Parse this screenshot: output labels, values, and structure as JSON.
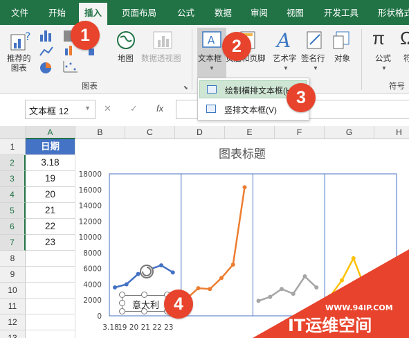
{
  "tabs": [
    "文件",
    "开始",
    "插入",
    "页面布局",
    "公式",
    "数据",
    "审阅",
    "视图",
    "开发工具",
    "形状格式"
  ],
  "ribbon": {
    "recommended_chart": "推荐的\n图表",
    "map": "地图",
    "pivot_chart": "数据透视图",
    "group_chart": "图表",
    "textbox": "文本框",
    "header_footer": "页眉和页脚",
    "wordart": "艺术字",
    "signature": "签名行",
    "object": "对象",
    "equation": "公式",
    "symbol": "符",
    "group_symbol": "符号"
  },
  "dropdown": {
    "horizontal": "绘制横排文本框(H)",
    "vertical": "竖排文本框(V)"
  },
  "formula": {
    "name_box": "文本框 12",
    "cancel": "✕",
    "enter": "✓",
    "fx": "fx"
  },
  "columns": [
    "A",
    "B",
    "C",
    "D",
    "E",
    "F",
    "G",
    "H"
  ],
  "rows": [
    "1",
    "2",
    "3",
    "4",
    "5",
    "6",
    "7",
    "8",
    "9",
    "10",
    "11",
    "12",
    "13"
  ],
  "cells": [
    "日期",
    "3.18",
    "19",
    "20",
    "21",
    "22",
    "23"
  ],
  "chart": {
    "title": "图表标题",
    "y_ticks": [
      "18000",
      "16000",
      "14000",
      "12000",
      "10000",
      "8000",
      "6000",
      "4000",
      "2000",
      "0"
    ],
    "x_labels": [
      "3.18",
      "19",
      "20",
      "21",
      "22",
      "23"
    ],
    "textbox_text": "意大利"
  },
  "chart_data": {
    "type": "line",
    "title": "图表标题",
    "ylim": [
      0,
      18000
    ],
    "categories": [
      "3.18",
      "19",
      "20",
      "21",
      "22",
      "23"
    ],
    "series": [
      {
        "values": [
          3600,
          4000,
          5300,
          5900,
          6400,
          5500
        ],
        "color": "#4472c4"
      },
      {
        "values": [
          2200,
          3500,
          3400,
          4800,
          6500,
          16300
        ],
        "color": "#ed7d31"
      },
      {
        "values": [
          1900,
          2400,
          3400,
          2800,
          5000,
          3600
        ],
        "color": "#a5a5a5"
      },
      {
        "values": [
          2500,
          4500,
          7300,
          3500,
          3000,
          2800
        ],
        "color": "#ffc000"
      }
    ]
  },
  "badges": [
    "1",
    "2",
    "3",
    "4"
  ],
  "watermark": {
    "url": "WWW.94IP.COM",
    "brand": "IT运维空间"
  }
}
